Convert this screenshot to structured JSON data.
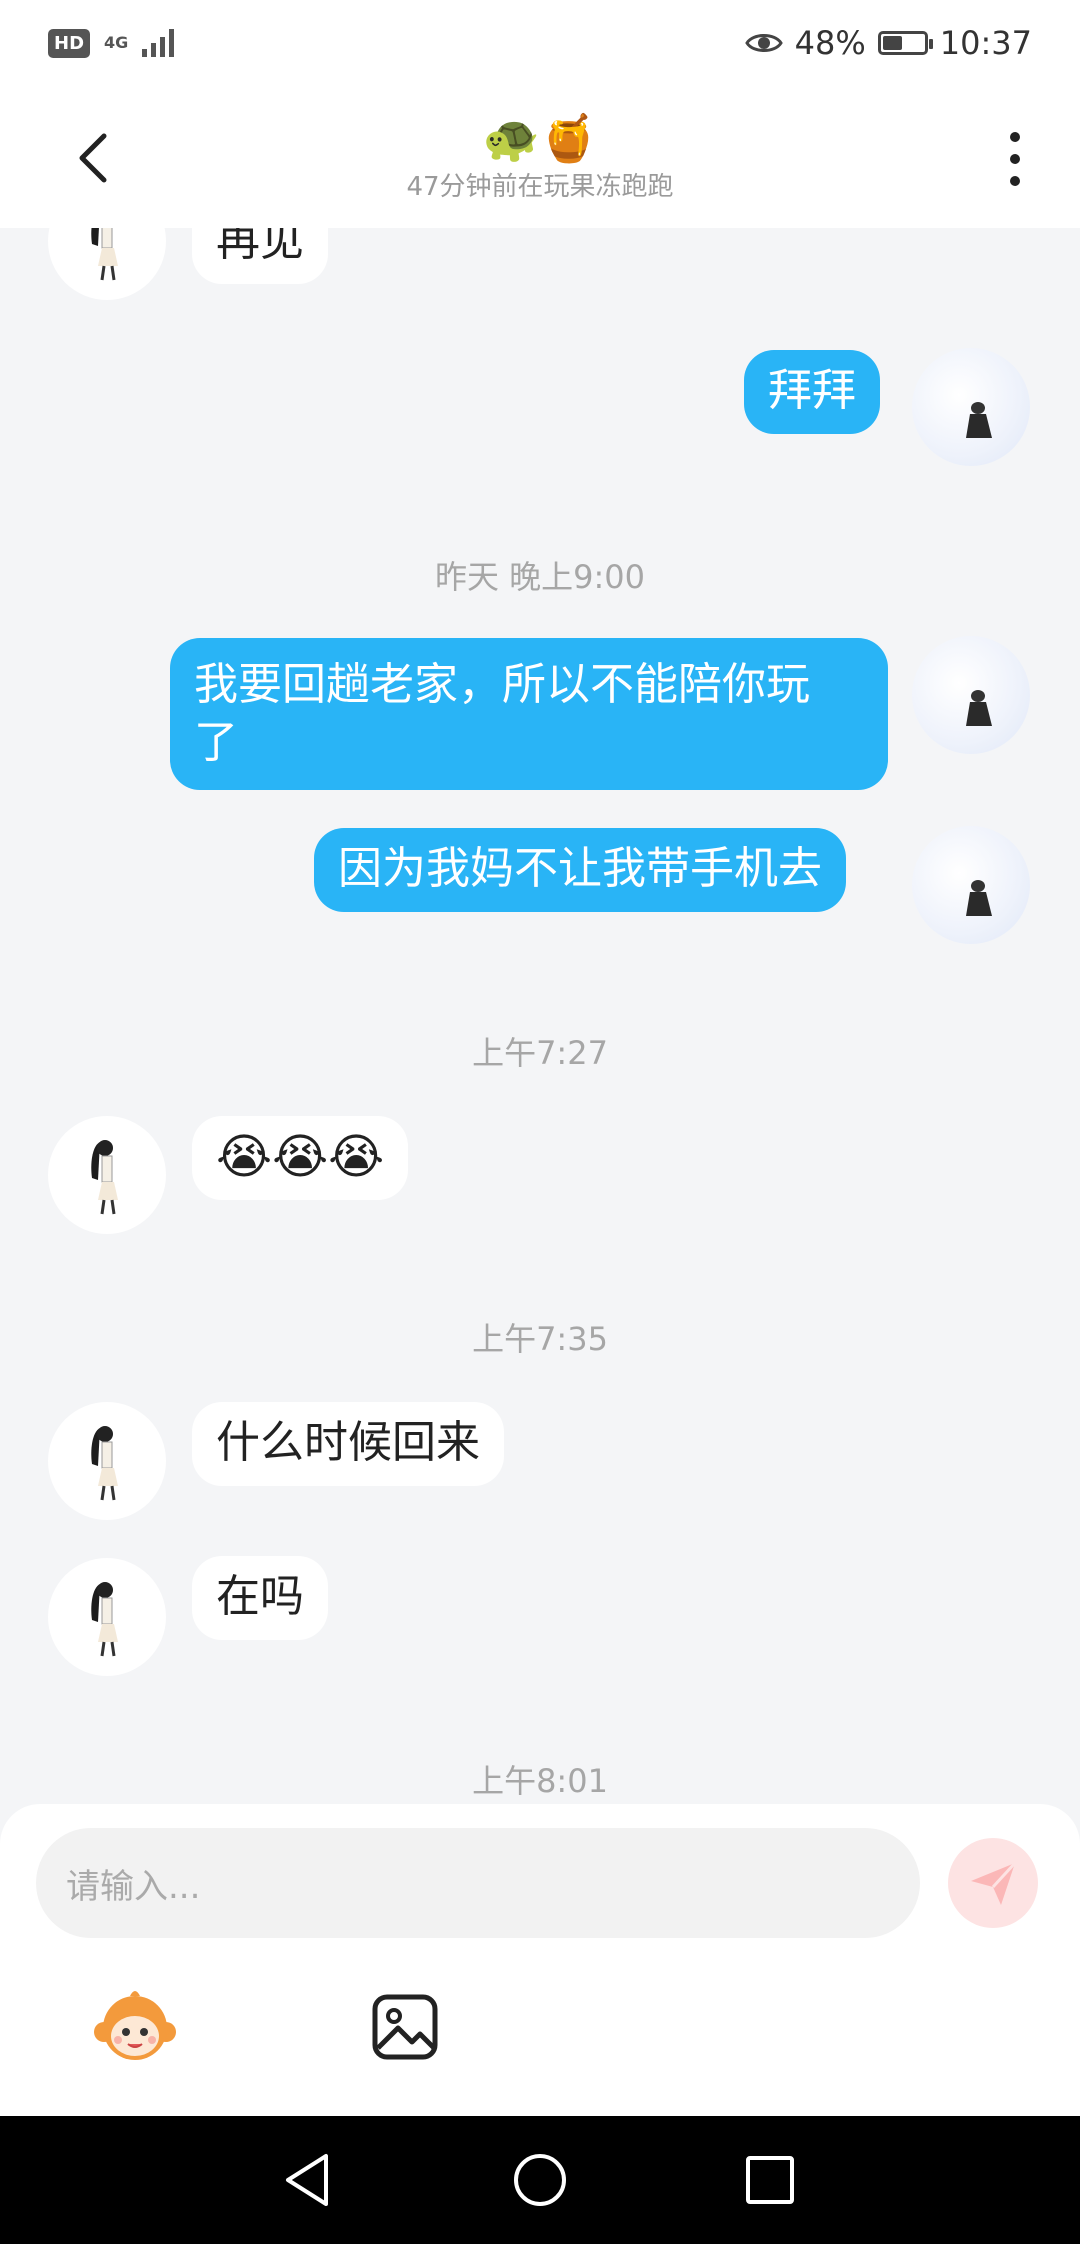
{
  "status_bar": {
    "hd": "HD",
    "network": "4G",
    "battery_percent": "48%",
    "battery_level": 0.48,
    "time": "10:37"
  },
  "header": {
    "title_emoji": "🐢🍯",
    "subtitle": "47分钟前在玩果冻跑跑"
  },
  "messages": {
    "m0": "再见",
    "m1": "拜拜",
    "t1": "昨天 晚上9:00",
    "m2": "我要回趟老家，所以不能陪你玩\n了",
    "m3": "因为我妈不让我带手机去",
    "t2": "上午7:27",
    "m4": "😭😭😭",
    "t3": "上午7:35",
    "m5": "什么时候回来",
    "m6": "在吗",
    "t4": "上午8:01"
  },
  "composer": {
    "placeholder": "请输入..."
  },
  "colors": {
    "outgoing_bubble": "#29b4f6",
    "incoming_bubble": "#ffffff",
    "background": "#f4f5f7",
    "send_button": "#fde3e3"
  },
  "icons": {
    "back": "chevron-left-icon",
    "more": "more-vertical-icon",
    "send": "paper-plane-icon",
    "sticker": "monkey-sticker-icon",
    "image": "image-icon",
    "nav_back": "triangle-back-icon",
    "nav_home": "circle-home-icon",
    "nav_recent": "square-recent-icon"
  }
}
